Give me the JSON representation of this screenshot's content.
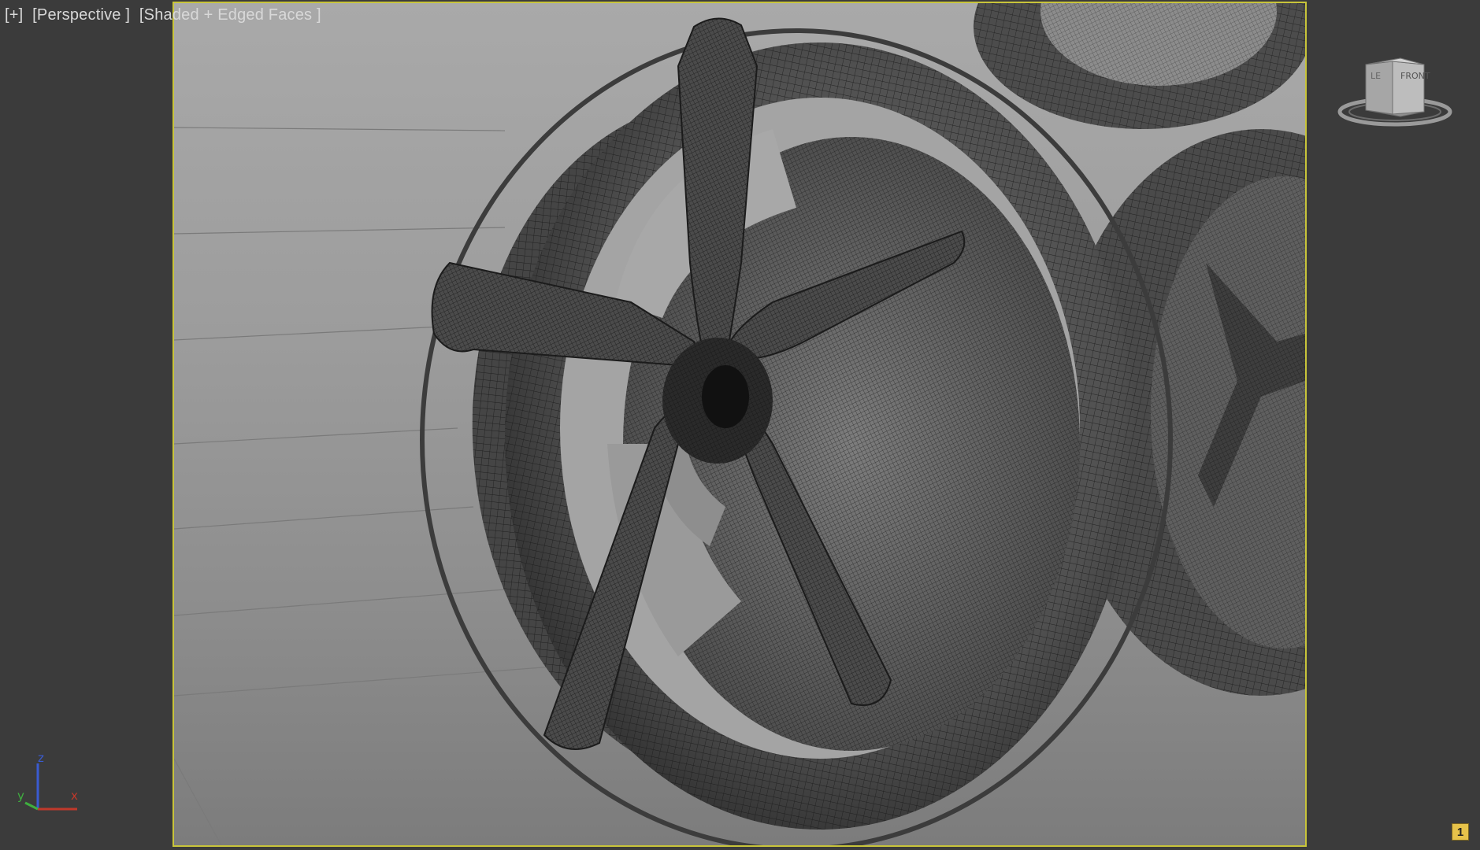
{
  "viewport": {
    "label_plus": "[+]",
    "label_view": "[Perspective ]",
    "label_shading": "[Shaded + Edged Faces ]"
  },
  "viewcube": {
    "face_front": "FRONT",
    "face_left": "LE"
  },
  "axis": {
    "z": "z",
    "y": "y",
    "x": "x"
  },
  "badge": {
    "number": "1"
  },
  "colors": {
    "frame_border": "#c8c43a",
    "ui_background": "#3b3b3b",
    "axis_x": "#c0392b",
    "axis_y": "#3fae3f",
    "axis_z": "#3a5bd0"
  }
}
